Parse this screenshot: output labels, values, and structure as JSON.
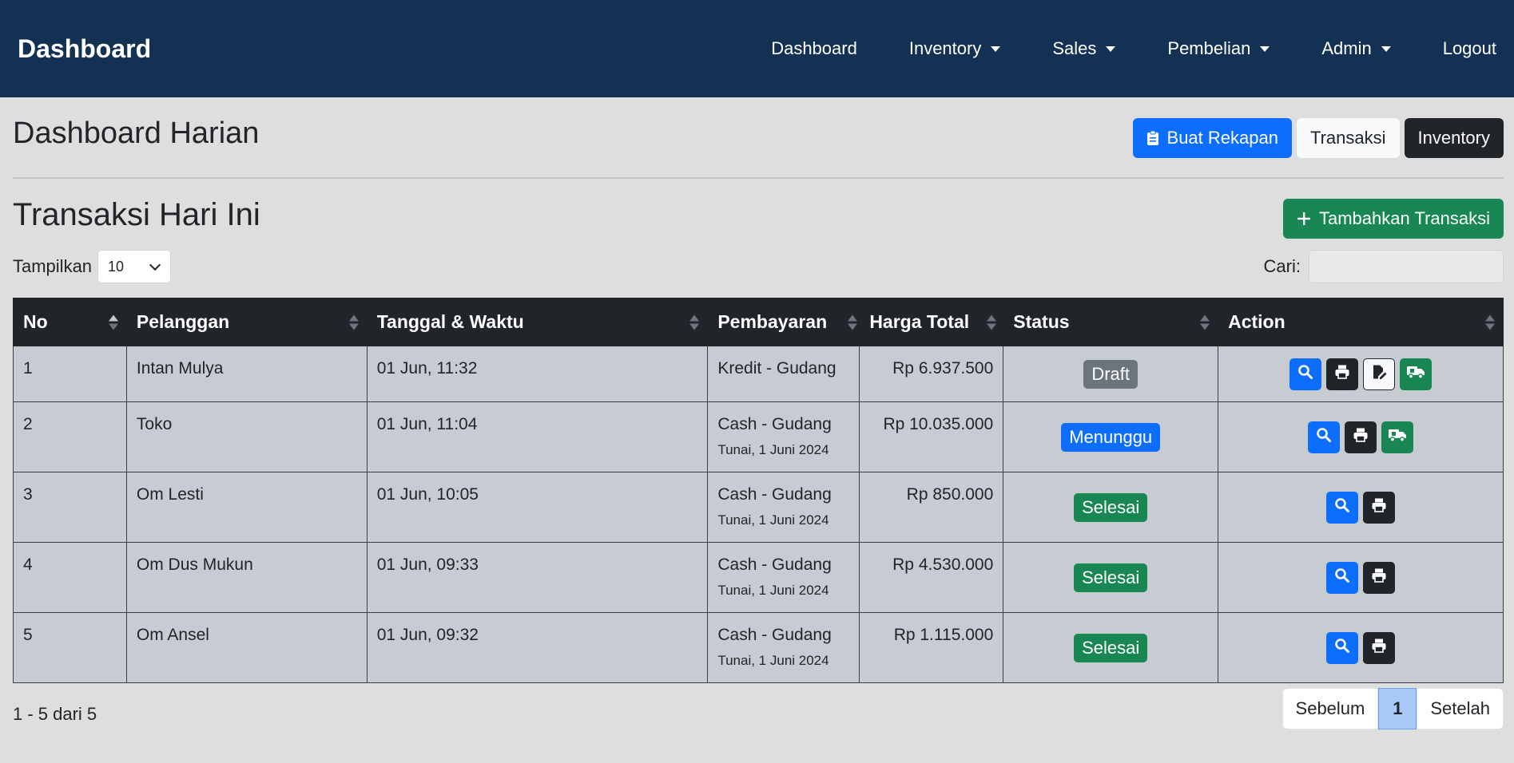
{
  "navbar": {
    "brand": "Dashboard",
    "items": [
      {
        "label": "Dashboard"
      },
      {
        "label": "Inventory"
      },
      {
        "label": "Sales"
      },
      {
        "label": "Pembelian"
      },
      {
        "label": "Admin"
      },
      {
        "label": "Logout"
      }
    ]
  },
  "header": {
    "title": "Dashboard Harian",
    "buttons": {
      "rekapan": "Buat Rekapan",
      "transaksi": "Transaksi",
      "inventory": "Inventory"
    }
  },
  "section": {
    "title": "Transaksi Hari Ini",
    "add_button": "Tambahkan Transaksi"
  },
  "controls": {
    "show_label": "Tampilkan",
    "show_value": "10",
    "search_label": "Cari:"
  },
  "table": {
    "headers": [
      "No",
      "Pelanggan",
      "Tanggal & Waktu",
      "Pembayaran",
      "Harga Total",
      "Status",
      "Action"
    ],
    "rows": [
      {
        "no": "1",
        "customer": "Intan Mulya",
        "datetime": "01 Jun, 11:32",
        "payment": "Kredit - Gudang",
        "payment_note": "",
        "total": "Rp 6.937.500",
        "status": "Draft"
      },
      {
        "no": "2",
        "customer": "Toko",
        "datetime": "01 Jun, 11:04",
        "payment": "Cash - Gudang",
        "payment_note": "Tunai, 1 Juni 2024",
        "total": "Rp 10.035.000",
        "status": "Menunggu"
      },
      {
        "no": "3",
        "customer": "Om Lesti",
        "datetime": "01 Jun, 10:05",
        "payment": "Cash - Gudang",
        "payment_note": "Tunai, 1 Juni 2024",
        "total": "Rp 850.000",
        "status": "Selesai"
      },
      {
        "no": "4",
        "customer": "Om Dus Mukun",
        "datetime": "01 Jun, 09:33",
        "payment": "Cash - Gudang",
        "payment_note": "Tunai, 1 Juni 2024",
        "total": "Rp 4.530.000",
        "status": "Selesai"
      },
      {
        "no": "5",
        "customer": "Om Ansel",
        "datetime": "01 Jun, 09:32",
        "payment": "Cash - Gudang",
        "payment_note": "Tunai, 1 Juni 2024",
        "total": "Rp 1.115.000",
        "status": "Selesai"
      }
    ]
  },
  "footer": {
    "info": "1 - 5 dari 5",
    "prev": "Sebelum",
    "page": "1",
    "next": "Setelah"
  },
  "colors": {
    "navbar": "#133253",
    "primary": "#0d6efd",
    "success": "#198754",
    "secondary": "#6c757d",
    "dark": "#212529"
  }
}
